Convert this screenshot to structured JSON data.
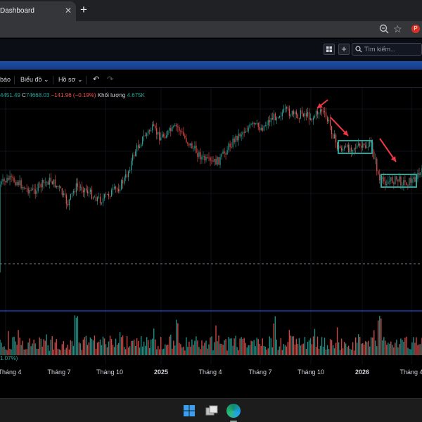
{
  "browser": {
    "tab_title": "Dashboard",
    "tab_close": "✕",
    "new_tab": "+"
  },
  "app": {
    "search_placeholder": "Tìm kiếm...",
    "add_label": "+"
  },
  "toolbar": {
    "items": [
      "báo",
      "Biểu đồ",
      "Hồ sơ"
    ],
    "undo": "↶",
    "redo": "↷",
    "chevron": "⌄"
  },
  "legend": {
    "h_value": "4451.49",
    "c_label": "C",
    "c_value": "74668.03",
    "change": "−141.96 (−0.19%)",
    "volume_label": "Khối lượng",
    "volume_value": "4.675K",
    "lower_readout": "1.07%)"
  },
  "colors": {
    "up": "#26a69a",
    "down": "#ef5350",
    "annotation_arrow": "#f23645",
    "annotation_box": "#26a69a",
    "pane_divider": "#2962ff"
  },
  "chart_data": {
    "type": "candlestick",
    "x_ticks": [
      "Tháng 4",
      "Tháng 7",
      "Tháng 10",
      "2025",
      "Tháng 4",
      "Tháng 7",
      "Tháng 10",
      "2026",
      "Tháng 4"
    ],
    "x_tick_bold": [
      false,
      false,
      false,
      true,
      false,
      false,
      false,
      true,
      false
    ],
    "close_path": [
      [
        0,
        262
      ],
      [
        0.02,
        255
      ],
      [
        0.04,
        258
      ],
      [
        0.06,
        268
      ],
      [
        0.08,
        272
      ],
      [
        0.1,
        262
      ],
      [
        0.12,
        256
      ],
      [
        0.14,
        268
      ],
      [
        0.16,
        290
      ],
      [
        0.18,
        265
      ],
      [
        0.2,
        268
      ],
      [
        0.22,
        278
      ],
      [
        0.24,
        285
      ],
      [
        0.26,
        275
      ],
      [
        0.28,
        268
      ],
      [
        0.3,
        250
      ],
      [
        0.32,
        215
      ],
      [
        0.34,
        195
      ],
      [
        0.36,
        182
      ],
      [
        0.38,
        195
      ],
      [
        0.4,
        188
      ],
      [
        0.42,
        180
      ],
      [
        0.44,
        198
      ],
      [
        0.46,
        212
      ],
      [
        0.48,
        225
      ],
      [
        0.5,
        232
      ],
      [
        0.52,
        228
      ],
      [
        0.54,
        210
      ],
      [
        0.56,
        195
      ],
      [
        0.58,
        185
      ],
      [
        0.6,
        178
      ],
      [
        0.62,
        182
      ],
      [
        0.64,
        170
      ],
      [
        0.66,
        162
      ],
      [
        0.68,
        158
      ],
      [
        0.7,
        165
      ],
      [
        0.72,
        160
      ],
      [
        0.74,
        168
      ],
      [
        0.76,
        155
      ],
      [
        0.78,
        175
      ],
      [
        0.8,
        210
      ],
      [
        0.82,
        212
      ],
      [
        0.84,
        208
      ],
      [
        0.86,
        210
      ],
      [
        0.88,
        205
      ],
      [
        0.9,
        258
      ],
      [
        0.92,
        258
      ],
      [
        0.94,
        255
      ],
      [
        0.96,
        260
      ],
      [
        0.98,
        255
      ],
      [
        1.0,
        245
      ]
    ],
    "volume_spikes": [
      0.18,
      0.42,
      0.65,
      0.9
    ]
  }
}
